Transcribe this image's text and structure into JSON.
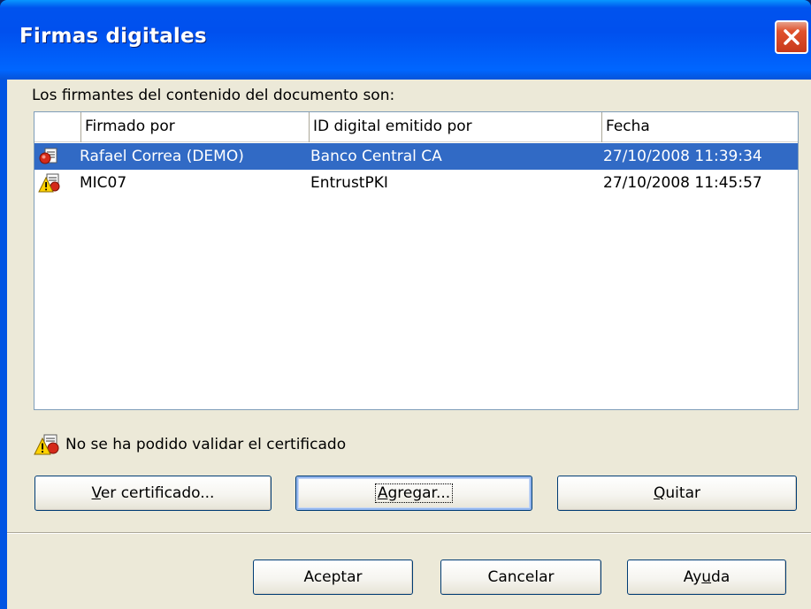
{
  "window": {
    "title": "Firmas digitales"
  },
  "intro_text": "Los firmantes del contenido del documento son:",
  "table": {
    "columns": [
      "",
      "Firmado por",
      "ID digital emitido por",
      "Fecha"
    ],
    "rows": [
      {
        "icon": "signature-valid-icon",
        "signed_by": "Rafael Correa  (DEMO)",
        "issuer": "Banco Central CA",
        "date": "27/10/2008 11:39:34",
        "selected": true
      },
      {
        "icon": "signature-warning-icon",
        "signed_by": "MIC07",
        "issuer": "EntrustPKI",
        "date": "27/10/2008 11:45:57",
        "selected": false
      }
    ]
  },
  "status": {
    "icon": "certificate-warning-icon",
    "text": "No se ha podido validar el certificado"
  },
  "buttons": {
    "view_certificate": {
      "label_accel": "V",
      "label_rest": "er certificado..."
    },
    "add": {
      "label_accel": "A",
      "label_rest": "gregar..."
    },
    "remove": {
      "label_accel": "Q",
      "label_rest": "uitar"
    },
    "ok": {
      "label": "Aceptar"
    },
    "cancel": {
      "label": "Cancelar"
    },
    "help": {
      "label_pre": "Ay",
      "label_accel": "u",
      "label_post": "da"
    }
  },
  "colors": {
    "titlebar": "#0054e3",
    "selection": "#316ac5",
    "dialog_bg": "#ece9d8",
    "close_button": "#e0522d"
  }
}
